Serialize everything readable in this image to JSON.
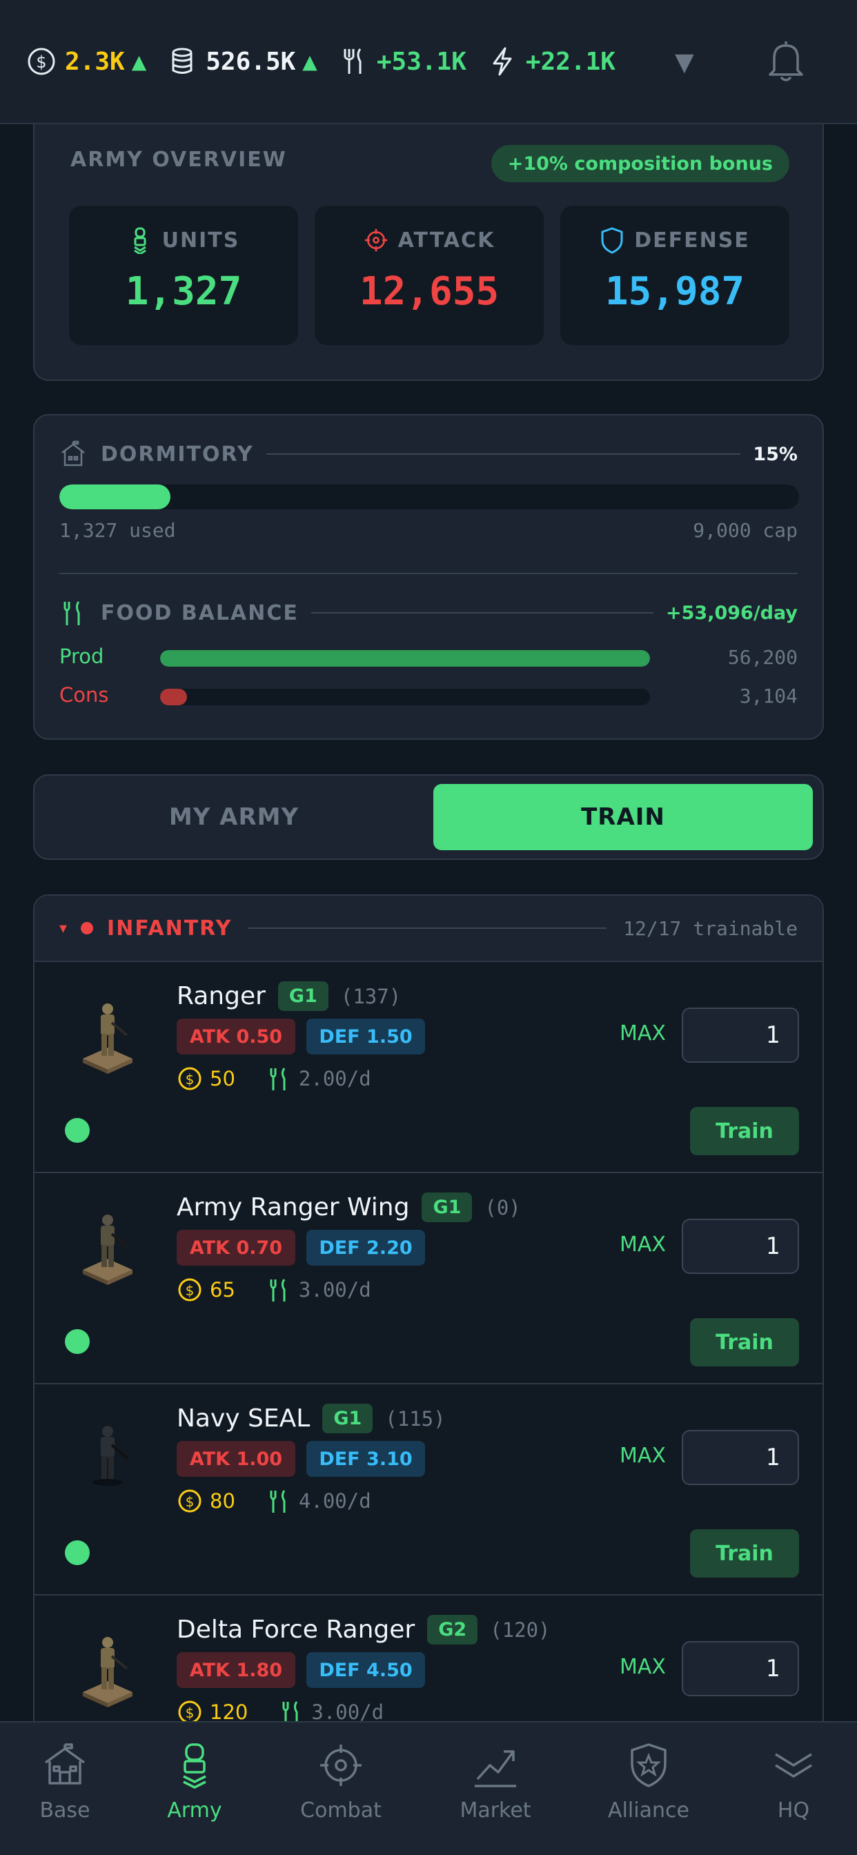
{
  "topbar": {
    "resources": [
      {
        "icon": "coin-icon",
        "value": "2.3K",
        "color": "#facc15",
        "trend": "▲"
      },
      {
        "icon": "database-icon",
        "value": "526.5K",
        "color": "#f1f5f9",
        "trend": "▲"
      },
      {
        "icon": "food-icon",
        "value": "+53.1K",
        "color": "#4ade80",
        "trend": ""
      },
      {
        "icon": "lightning-icon",
        "value": "+22.1K",
        "color": "#4ade80",
        "trend": ""
      }
    ],
    "dropdown_glyph": "▼"
  },
  "overview": {
    "title": "ARMY OVERVIEW",
    "bonus": "+10% composition bonus",
    "stats": [
      {
        "label": "UNITS",
        "value": "1,327",
        "color": "#4ade80",
        "icon": "soldier-icon"
      },
      {
        "label": "ATTACK",
        "value": "12,655",
        "color": "#ef4444",
        "icon": "crosshair-icon"
      },
      {
        "label": "DEFENSE",
        "value": "15,987",
        "color": "#38bdf8",
        "icon": "shield-icon"
      }
    ]
  },
  "dormitory": {
    "title": "DORMITORY",
    "percent": "15%",
    "fill_fraction": 0.15,
    "used": "1,327 used",
    "cap": "9,000 cap"
  },
  "food": {
    "title": "FOOD BALANCE",
    "balance": "+53,096/day",
    "prod_label": "Prod",
    "prod_value": "56,200",
    "prod_fraction": 1.0,
    "cons_label": "Cons",
    "cons_value": "3,104",
    "cons_fraction": 0.055
  },
  "tabs": {
    "my_army": "MY ARMY",
    "train": "TRAIN"
  },
  "category": {
    "arrow": "▾",
    "name": "INFANTRY",
    "count": "12/17 trainable"
  },
  "units": [
    {
      "name": "Ranger",
      "grade": "G1",
      "owned": "(137)",
      "atk": "ATK 0.50",
      "def": "DEF 1.50",
      "gold": "50",
      "food": "2.00/d",
      "qty": "1"
    },
    {
      "name": "Army Ranger Wing",
      "grade": "G1",
      "owned": "(0)",
      "atk": "ATK 0.70",
      "def": "DEF 2.20",
      "gold": "65",
      "food": "3.00/d",
      "qty": "1"
    },
    {
      "name": "Navy SEAL",
      "grade": "G1",
      "owned": "(115)",
      "atk": "ATK 1.00",
      "def": "DEF 3.10",
      "gold": "80",
      "food": "4.00/d",
      "qty": "1"
    },
    {
      "name": "Delta Force Ranger",
      "grade": "G2",
      "owned": "(120)",
      "atk": "ATK 1.80",
      "def": "DEF 4.50",
      "gold": "120",
      "food": "3.00/d",
      "qty": "1"
    }
  ],
  "labels": {
    "max": "MAX",
    "train": "Train"
  },
  "nav": [
    {
      "label": "Base",
      "icon": "house-icon",
      "active": false
    },
    {
      "label": "Army",
      "icon": "soldier-icon",
      "active": true
    },
    {
      "label": "Combat",
      "icon": "crosshair-icon",
      "active": false
    },
    {
      "label": "Market",
      "icon": "chart-icon",
      "active": false
    },
    {
      "label": "Alliance",
      "icon": "shield-star-icon",
      "active": false
    },
    {
      "label": "HQ",
      "icon": "chevrons-icon",
      "active": false
    }
  ]
}
